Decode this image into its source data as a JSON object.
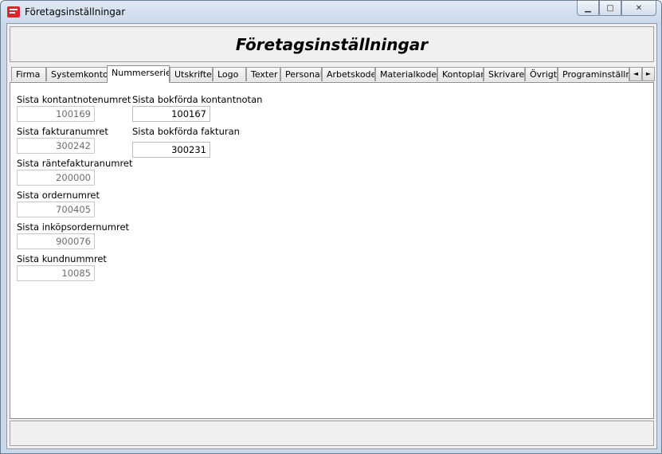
{
  "window": {
    "title": "Företagsinställningar",
    "controls": {
      "minimize": "▁",
      "maximize": "□",
      "close": "✕"
    }
  },
  "header": {
    "title": "Företagsinställningar"
  },
  "tabs": [
    {
      "label": "Firma"
    },
    {
      "label": "Systemkonton"
    },
    {
      "label": "Nummerserier",
      "active": true
    },
    {
      "label": "Utskrifter"
    },
    {
      "label": "Logo"
    },
    {
      "label": "Texter"
    },
    {
      "label": "Personal"
    },
    {
      "label": "Arbetskoder"
    },
    {
      "label": "Materialkoder"
    },
    {
      "label": "Kontoplan"
    },
    {
      "label": "Skrivare"
    },
    {
      "label": "Övrigt"
    },
    {
      "label": "Programinställningar"
    }
  ],
  "tab_scroll": {
    "left": "◄",
    "right": "►"
  },
  "left_fields": [
    {
      "label": "Sista kontantnotenumret",
      "value": "100169"
    },
    {
      "label": "Sista fakturanumret",
      "value": "300242"
    },
    {
      "label": "Sista räntefakturanumret",
      "value": "200000"
    },
    {
      "label": "Sista ordernumret",
      "value": "700405"
    },
    {
      "label": "Sista inköpsordernumret",
      "value": "900076"
    },
    {
      "label": "Sista kundnummret",
      "value": "10085"
    }
  ],
  "right_fields": [
    {
      "label": "Sista bokförda kontantnotan",
      "value": "100167"
    },
    {
      "label": "Sista bokförda fakturan",
      "value": "300231"
    }
  ],
  "icons": {
    "app": "app-icon",
    "scroll_left": "scroll-left-icon",
    "scroll_right": "scroll-right-icon"
  }
}
